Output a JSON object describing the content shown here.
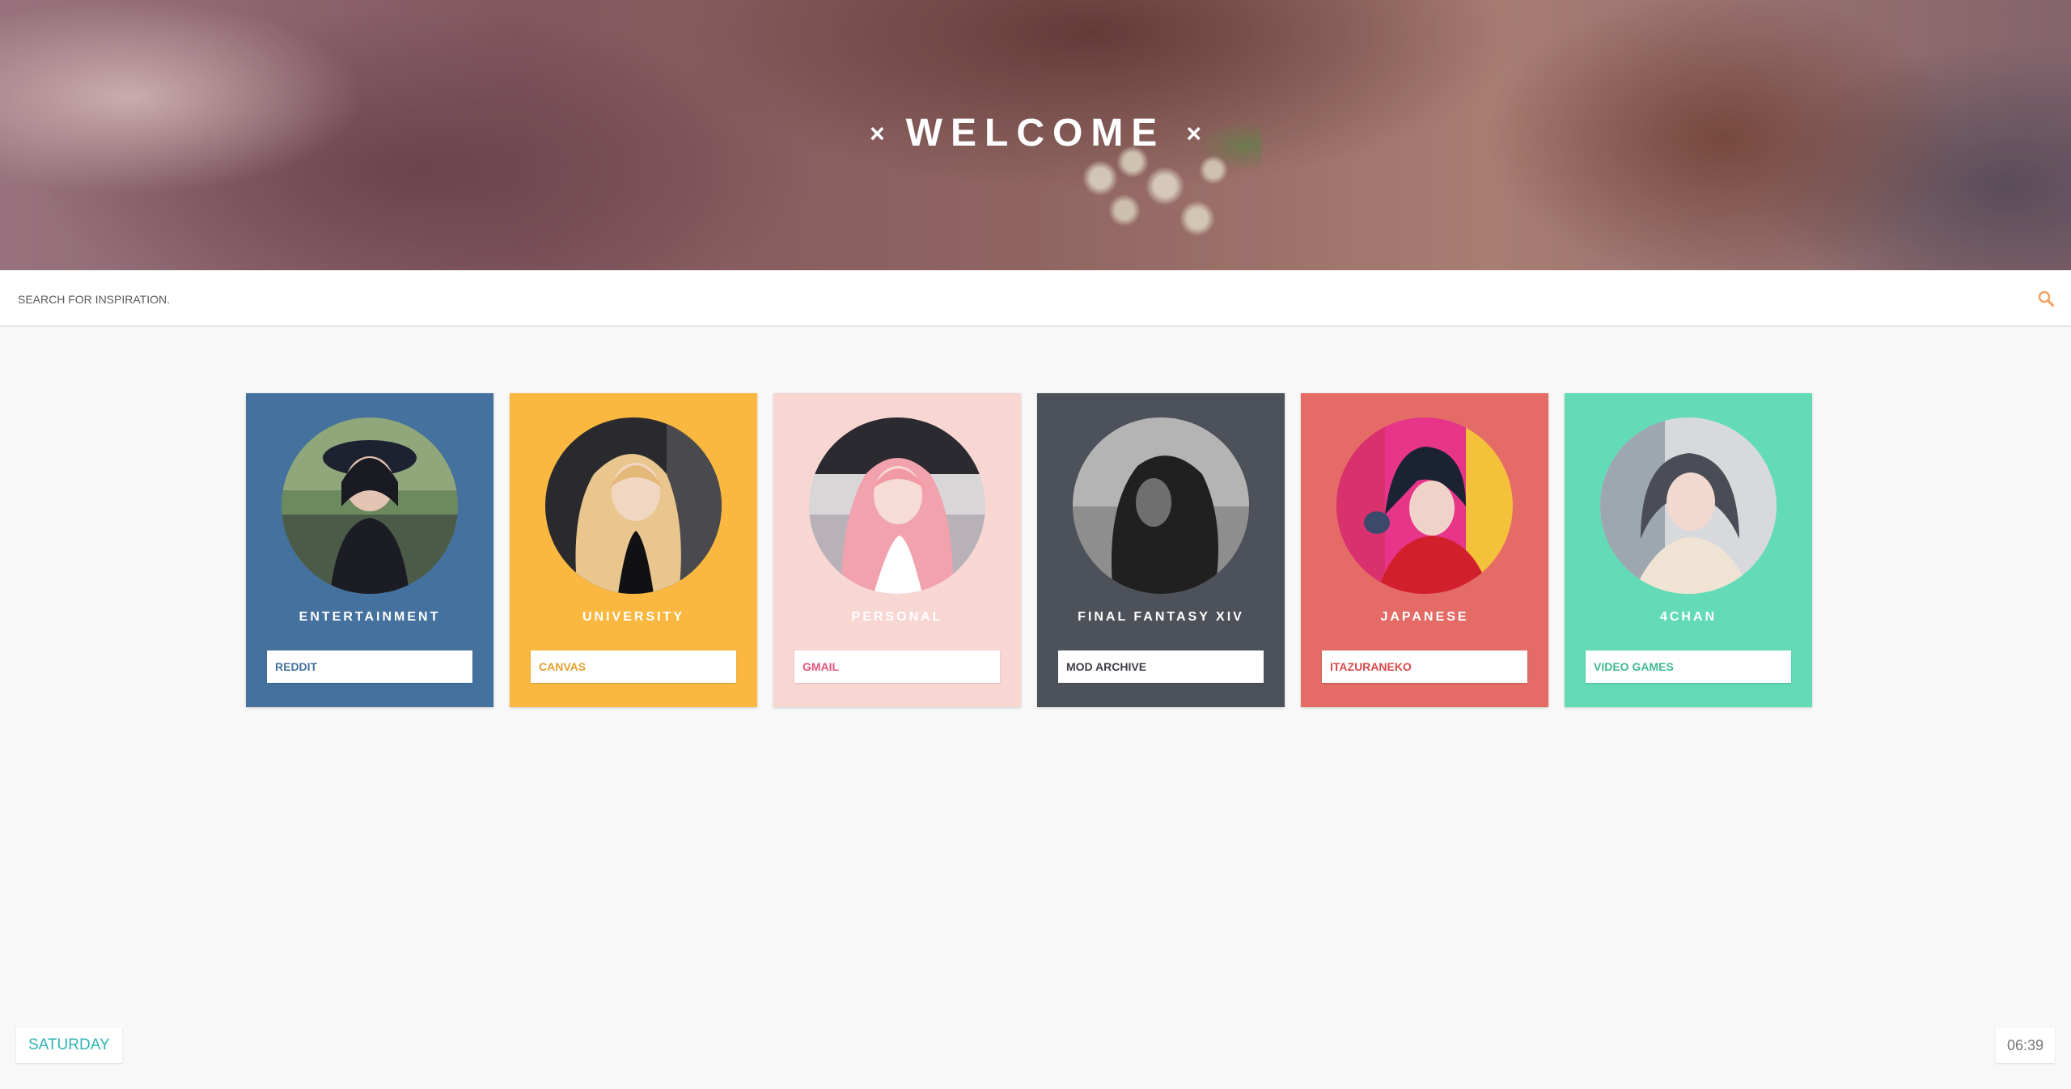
{
  "header": {
    "title": "WELCOME",
    "mark_left": "×",
    "mark_right": "×"
  },
  "search": {
    "placeholder": "SEARCH FOR INSPIRATION.",
    "value": "",
    "icon": "search-icon",
    "icon_color": "#f0a468"
  },
  "cards": [
    {
      "title": "ENTERTAINMENT",
      "link": "REDDIT",
      "bg": "#44719e",
      "link_color": "#44719e",
      "title_color": "#ffffff"
    },
    {
      "title": "UNIVERSITY",
      "link": "CANVAS",
      "bg": "#fab840",
      "link_color": "#e3a02c",
      "title_color": "#ffffff"
    },
    {
      "title": "PERSONAL",
      "link": "GMAIL",
      "bg": "#f8d7d3",
      "link_color": "#e0567a",
      "title_color": "#ffffff"
    },
    {
      "title": "FINAL FANTASY XIV",
      "link": "MOD ARCHIVE",
      "bg": "#4d5159",
      "link_color": "#3c3f45",
      "title_color": "#ffffff"
    },
    {
      "title": "JAPANESE",
      "link": "ITAZURANEKO",
      "bg": "#e46b66",
      "link_color": "#d8484a",
      "title_color": "#ffffff"
    },
    {
      "title": "4CHAN",
      "link": "VIDEO GAMES",
      "bg": "#62dbb6",
      "link_color": "#3fb990",
      "title_color": "#ffffff"
    }
  ],
  "footer": {
    "day": "SATURDAY",
    "time": "06:39",
    "day_color": "#2fb3b3"
  }
}
